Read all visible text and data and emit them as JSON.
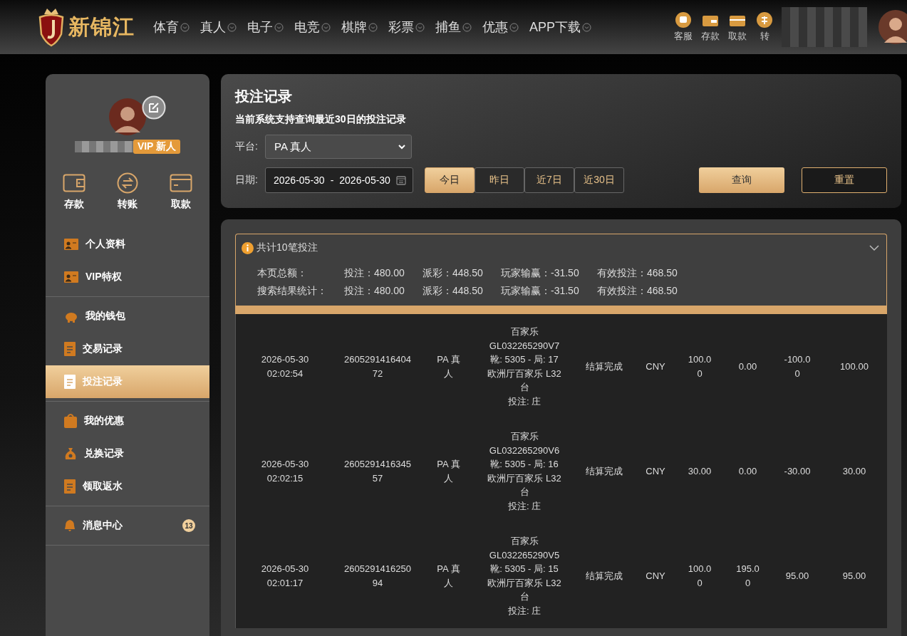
{
  "header": {
    "logo_text": "新锦江",
    "nav": [
      {
        "label": "体育"
      },
      {
        "label": "真人"
      },
      {
        "label": "电子"
      },
      {
        "label": "电竞"
      },
      {
        "label": "棋牌"
      },
      {
        "label": "彩票"
      },
      {
        "label": "捕鱼"
      },
      {
        "label": "优惠"
      },
      {
        "label": "APP下载"
      }
    ],
    "actions": [
      {
        "kind": "service",
        "label": "客服"
      },
      {
        "kind": "deposit",
        "label": "存款"
      },
      {
        "kind": "withdraw",
        "label": "取款"
      },
      {
        "kind": "transfer",
        "label": "转"
      }
    ]
  },
  "sidebar": {
    "vip_badge": "VIP 新人",
    "quick_actions": [
      {
        "kind": "wallet",
        "label": "存款"
      },
      {
        "kind": "transfer",
        "label": "转账"
      },
      {
        "kind": "card",
        "label": "取款"
      }
    ],
    "groups": [
      [
        {
          "kind": "id",
          "label": "个人资料",
          "selected": false
        },
        {
          "kind": "id",
          "label": "VIP特权",
          "selected": false
        }
      ],
      [
        {
          "kind": "piggy",
          "label": "我的钱包",
          "selected": false
        },
        {
          "kind": "doc",
          "label": "交易记录",
          "selected": false
        },
        {
          "kind": "doc",
          "label": "投注记录",
          "selected": true
        }
      ],
      [
        {
          "kind": "bag",
          "label": "我的优惠",
          "selected": false
        },
        {
          "kind": "money",
          "label": "兑换记录",
          "selected": false
        },
        {
          "kind": "doc",
          "label": "领取返水",
          "selected": false
        }
      ],
      [
        {
          "kind": "bell",
          "label": "消息中心",
          "selected": false,
          "badge": "13"
        }
      ]
    ]
  },
  "filter": {
    "title": "投注记录",
    "note": "当前系统支持查询最近30日的投注记录",
    "platform_label": "平台:",
    "platform": "PA 真人",
    "date_label": "日期:",
    "date_from": "2026-05-30",
    "date_sep": "-",
    "date_to": "2026-05-30",
    "ranges": [
      {
        "label": "今日",
        "selected": true
      },
      {
        "label": "昨日",
        "selected": false
      },
      {
        "label": "近7日",
        "selected": false
      },
      {
        "label": "近30日",
        "selected": false
      }
    ],
    "query_button": "查询",
    "reset_button": "重置"
  },
  "summary": {
    "title": "共计10笔投注",
    "rows": [
      {
        "label": "本页总额：",
        "bet": "投注：480.00",
        "payout": "派彩：448.50",
        "winloss": "玩家输赢：-31.50",
        "valid": "有效投注：468.50"
      },
      {
        "label": "搜索结果统计：",
        "bet": "投注：480.00",
        "payout": "派彩：448.50",
        "winloss": "玩家输赢：-31.50",
        "valid": "有效投注：468.50"
      }
    ]
  },
  "records": [
    {
      "time": "2026-05-30 02:02:54",
      "order": "260529141640472",
      "platform": "PA 真人",
      "detail": [
        "百家乐",
        "GL032265290V7",
        "靴: 5305 - 局: 17",
        "欧洲厅百家乐 L32台",
        "投注: 庄"
      ],
      "status": "结算完成",
      "currency": "CNY",
      "bet": "100.00",
      "payout": "0.00",
      "winloss": "-100.00",
      "valid": "100.00"
    },
    {
      "time": "2026-05-30 02:02:15",
      "order": "260529141634557",
      "platform": "PA 真人",
      "detail": [
        "百家乐",
        "GL032265290V6",
        "靴: 5305 - 局: 16",
        "欧洲厅百家乐 L32台",
        "投注: 庄"
      ],
      "status": "结算完成",
      "currency": "CNY",
      "bet": "30.00",
      "payout": "0.00",
      "winloss": "-30.00",
      "valid": "30.00"
    },
    {
      "time": "2026-05-30 02:01:17",
      "order": "260529141625094",
      "platform": "PA 真人",
      "detail": [
        "百家乐",
        "GL032265290V5",
        "靴: 5305 - 局: 15",
        "欧洲厅百家乐 L32台",
        "投注: 庄"
      ],
      "status": "结算完成",
      "currency": "CNY",
      "bet": "100.00",
      "payout": "195.00",
      "winloss": "95.00",
      "valid": "95.00"
    }
  ]
}
